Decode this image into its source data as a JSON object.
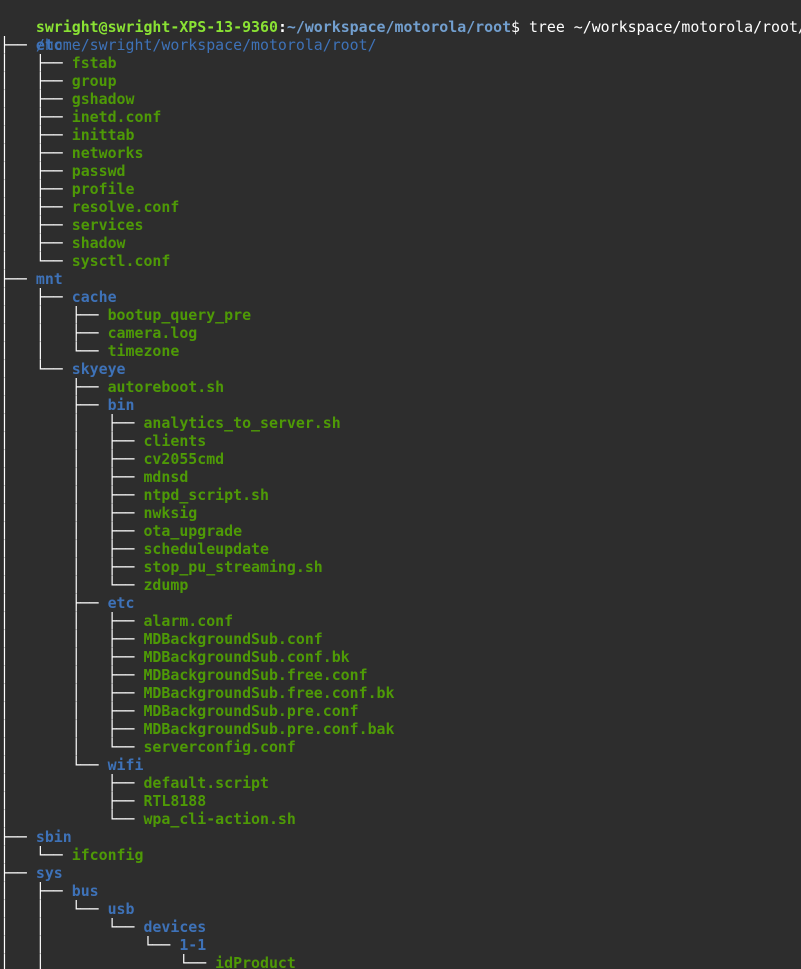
{
  "prompt": {
    "user_host": "swright@swright-XPS-13-9360",
    "colon": ":",
    "cwd": "~/workspace/motorola/root",
    "dollar": "$",
    "command": " tree ~/workspace/motorola/root/"
  },
  "tree": {
    "root": "/home/swright/workspace/motorola/root/",
    "entries": [
      {
        "prefix": "├── ",
        "name": "etc",
        "type": "dir"
      },
      {
        "prefix": "│   ├── ",
        "name": "fstab",
        "type": "exe"
      },
      {
        "prefix": "│   ├── ",
        "name": "group",
        "type": "exe"
      },
      {
        "prefix": "│   ├── ",
        "name": "gshadow",
        "type": "exe"
      },
      {
        "prefix": "│   ├── ",
        "name": "inetd.conf",
        "type": "exe"
      },
      {
        "prefix": "│   ├── ",
        "name": "inittab",
        "type": "exe"
      },
      {
        "prefix": "│   ├── ",
        "name": "networks",
        "type": "exe"
      },
      {
        "prefix": "│   ├── ",
        "name": "passwd",
        "type": "exe"
      },
      {
        "prefix": "│   ├── ",
        "name": "profile",
        "type": "exe"
      },
      {
        "prefix": "│   ├── ",
        "name": "resolve.conf",
        "type": "exe"
      },
      {
        "prefix": "│   ├── ",
        "name": "services",
        "type": "exe"
      },
      {
        "prefix": "│   ├── ",
        "name": "shadow",
        "type": "exe"
      },
      {
        "prefix": "│   └── ",
        "name": "sysctl.conf",
        "type": "exe"
      },
      {
        "prefix": "├── ",
        "name": "mnt",
        "type": "dir"
      },
      {
        "prefix": "│   ├── ",
        "name": "cache",
        "type": "dir"
      },
      {
        "prefix": "│   │   ├── ",
        "name": "bootup_query_pre",
        "type": "exe"
      },
      {
        "prefix": "│   │   ├── ",
        "name": "camera.log",
        "type": "exe"
      },
      {
        "prefix": "│   │   └── ",
        "name": "timezone",
        "type": "exe"
      },
      {
        "prefix": "│   └── ",
        "name": "skyeye",
        "type": "dir"
      },
      {
        "prefix": "│       ├── ",
        "name": "autoreboot.sh",
        "type": "exe"
      },
      {
        "prefix": "│       ├── ",
        "name": "bin",
        "type": "dir"
      },
      {
        "prefix": "│       │   ├── ",
        "name": "analytics_to_server.sh",
        "type": "exe"
      },
      {
        "prefix": "│       │   ├── ",
        "name": "clients",
        "type": "exe"
      },
      {
        "prefix": "│       │   ├── ",
        "name": "cv2055cmd",
        "type": "exe"
      },
      {
        "prefix": "│       │   ├── ",
        "name": "mdnsd",
        "type": "exe"
      },
      {
        "prefix": "│       │   ├── ",
        "name": "ntpd_script.sh",
        "type": "exe"
      },
      {
        "prefix": "│       │   ├── ",
        "name": "nwksig",
        "type": "exe"
      },
      {
        "prefix": "│       │   ├── ",
        "name": "ota_upgrade",
        "type": "exe"
      },
      {
        "prefix": "│       │   ├── ",
        "name": "scheduleupdate",
        "type": "exe"
      },
      {
        "prefix": "│       │   ├── ",
        "name": "stop_pu_streaming.sh",
        "type": "exe"
      },
      {
        "prefix": "│       │   └── ",
        "name": "zdump",
        "type": "exe"
      },
      {
        "prefix": "│       ├── ",
        "name": "etc",
        "type": "dir"
      },
      {
        "prefix": "│       │   ├── ",
        "name": "alarm.conf",
        "type": "exe"
      },
      {
        "prefix": "│       │   ├── ",
        "name": "MDBackgroundSub.conf",
        "type": "exe"
      },
      {
        "prefix": "│       │   ├── ",
        "name": "MDBackgroundSub.conf.bk",
        "type": "exe"
      },
      {
        "prefix": "│       │   ├── ",
        "name": "MDBackgroundSub.free.conf",
        "type": "exe"
      },
      {
        "prefix": "│       │   ├── ",
        "name": "MDBackgroundSub.free.conf.bk",
        "type": "exe"
      },
      {
        "prefix": "│       │   ├── ",
        "name": "MDBackgroundSub.pre.conf",
        "type": "exe"
      },
      {
        "prefix": "│       │   ├── ",
        "name": "MDBackgroundSub.pre.conf.bak",
        "type": "exe"
      },
      {
        "prefix": "│       │   └── ",
        "name": "serverconfig.conf",
        "type": "exe"
      },
      {
        "prefix": "│       └── ",
        "name": "wifi",
        "type": "dir"
      },
      {
        "prefix": "│           ├── ",
        "name": "default.script",
        "type": "exe"
      },
      {
        "prefix": "│           ├── ",
        "name": "RTL8188",
        "type": "exe"
      },
      {
        "prefix": "│           └── ",
        "name": "wpa_cli-action.sh",
        "type": "exe"
      },
      {
        "prefix": "├── ",
        "name": "sbin",
        "type": "dir"
      },
      {
        "prefix": "│   └── ",
        "name": "ifconfig",
        "type": "exe"
      },
      {
        "prefix": "├── ",
        "name": "sys",
        "type": "dir"
      },
      {
        "prefix": "│   ├── ",
        "name": "bus",
        "type": "dir"
      },
      {
        "prefix": "│   │   └── ",
        "name": "usb",
        "type": "dir"
      },
      {
        "prefix": "│   │       └── ",
        "name": "devices",
        "type": "dir"
      },
      {
        "prefix": "│   │           └── ",
        "name": "1-1",
        "type": "dir"
      },
      {
        "prefix": "│   │               └── ",
        "name": "idProduct",
        "type": "exe"
      },
      {
        "prefix": "│   │               ",
        "name": "",
        "type": "exe"
      }
    ]
  },
  "colors": {
    "background": "#2d2d2d",
    "prompt_user": "#8ae234",
    "prompt_cwd": "#729fcf",
    "directory": "#3e72b8",
    "executable": "#4e9a06",
    "tree_guides": "#ffffff"
  }
}
